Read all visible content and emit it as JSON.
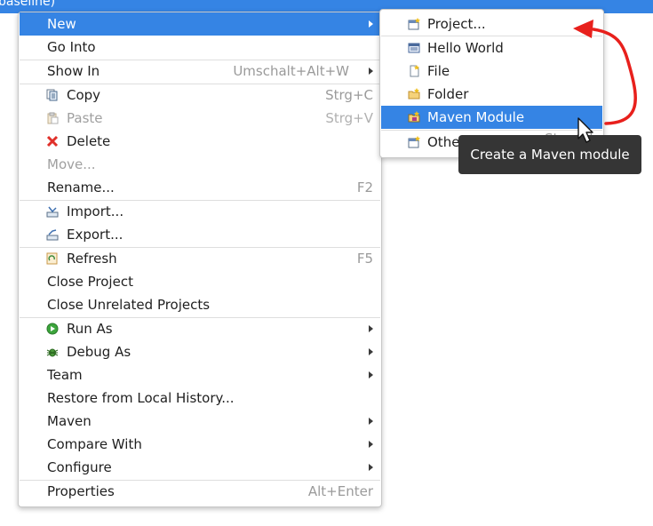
{
  "window": {
    "title_fragment": "baseline)"
  },
  "context_menu": {
    "new": "New",
    "go_into": "Go Into",
    "show_in": "Show In",
    "show_in_shortcut": "Umschalt+Alt+W",
    "copy": "Copy",
    "copy_shortcut": "Strg+C",
    "paste": "Paste",
    "paste_shortcut": "Strg+V",
    "delete": "Delete",
    "move": "Move...",
    "rename": "Rename...",
    "rename_shortcut": "F2",
    "import": "Import...",
    "export": "Export...",
    "refresh": "Refresh",
    "refresh_shortcut": "F5",
    "close_project": "Close Project",
    "close_unrelated": "Close Unrelated Projects",
    "run_as": "Run As",
    "debug_as": "Debug As",
    "team": "Team",
    "restore": "Restore from Local History...",
    "maven": "Maven",
    "compare_with": "Compare With",
    "configure": "Configure",
    "properties": "Properties",
    "properties_shortcut": "Alt+Enter"
  },
  "submenu": {
    "project": "Project...",
    "hello_world": "Hello World",
    "file": "File",
    "folder": "Folder",
    "maven_module": "Maven Module",
    "other": "Other...",
    "other_shortcut": "Strg+N"
  },
  "tooltip": {
    "text": "Create a Maven module"
  },
  "colors": {
    "highlight": "#3584e4",
    "annotation": "#e8201c",
    "tooltip_bg": "#353535"
  }
}
